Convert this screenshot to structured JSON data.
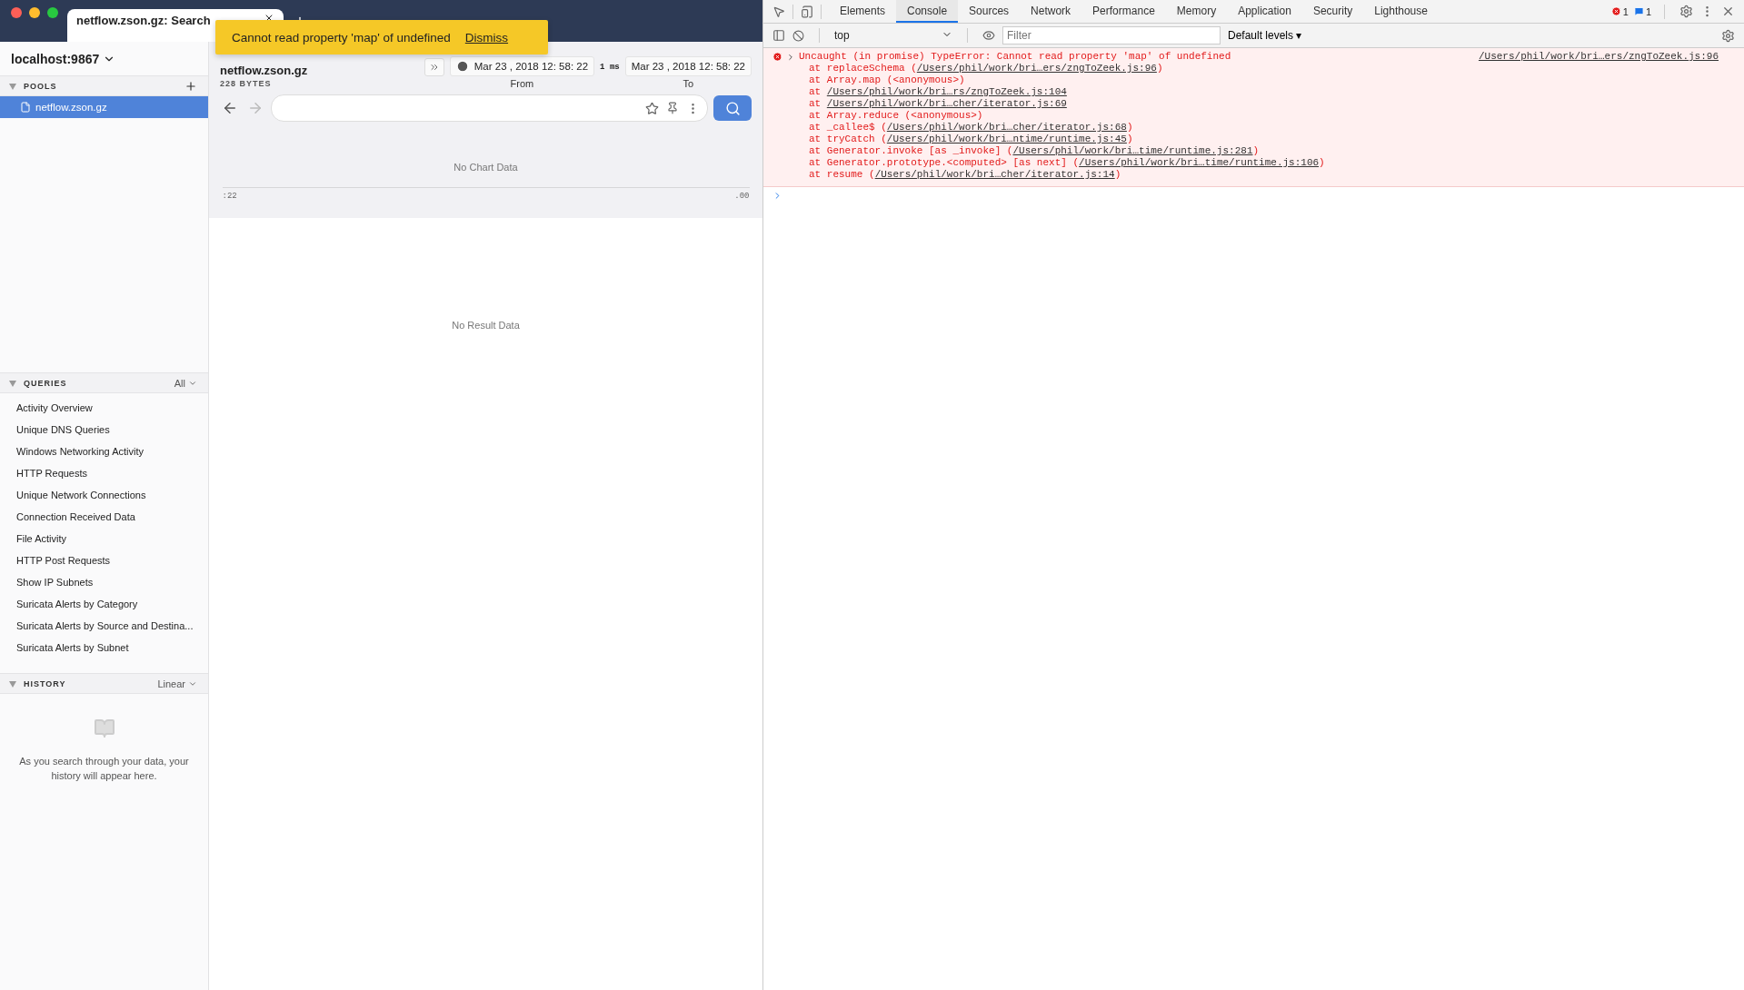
{
  "browser_tab": {
    "title": "netflow.zson.gz: Search"
  },
  "toast": {
    "message": "Cannot read property 'map' of undefined",
    "action": "Dismiss"
  },
  "sidebar": {
    "workspace": "localhost:9867",
    "pools": {
      "title": "POOLS",
      "items": [
        {
          "name": "netflow.zson.gz",
          "selected": true
        }
      ]
    },
    "queries": {
      "title": "QUERIES",
      "filter": "All",
      "items": [
        {
          "name": "Activity Overview",
          "selected": false
        },
        {
          "name": "Unique DNS Queries",
          "selected": false
        },
        {
          "name": "Windows Networking Activity",
          "selected": false
        },
        {
          "name": "HTTP Requests",
          "selected": false
        },
        {
          "name": "Unique Network Connections",
          "selected": false
        },
        {
          "name": "Connection Received Data",
          "selected": false
        },
        {
          "name": "File Activity",
          "selected": false
        },
        {
          "name": "HTTP Post Requests",
          "selected": false
        },
        {
          "name": "Show IP Subnets",
          "selected": false
        },
        {
          "name": "Suricata Alerts by Category",
          "selected": false
        },
        {
          "name": "Suricata Alerts by Source and Destina...",
          "selected": false
        },
        {
          "name": "Suricata Alerts by Subnet",
          "selected": false
        }
      ]
    },
    "history": {
      "title": "HISTORY",
      "mode": "Linear",
      "empty_message": "As you search through your data, your history will appear here."
    }
  },
  "main": {
    "pool_name": "netflow.zson.gz",
    "size": "228 BYTES",
    "from": "Mar 23 , 2018 12: 58: 22",
    "duration": "1 ms",
    "to": "Mar 23 , 2018 12: 58: 22",
    "from_label": "From",
    "to_label": "To",
    "chart": {
      "empty_message": "No Chart Data",
      "axis_labels": [
        ":22",
        ".00"
      ]
    },
    "results": {
      "empty_message": "No Result Data"
    }
  },
  "devtools": {
    "tabs": [
      {
        "label": "Elements",
        "selected": false
      },
      {
        "label": "Console",
        "selected": true
      },
      {
        "label": "Sources",
        "selected": false
      },
      {
        "label": "Network",
        "selected": false
      },
      {
        "label": "Performance",
        "selected": false
      },
      {
        "label": "Memory",
        "selected": false
      },
      {
        "label": "Application",
        "selected": false
      },
      {
        "label": "Security",
        "selected": false
      },
      {
        "label": "Lighthouse",
        "selected": false
      }
    ],
    "error_count": "1",
    "message_count": "1",
    "context": "top",
    "filter_placeholder": "Filter",
    "levels": "Default levels ▾",
    "error": {
      "message": "Uncaught (in promise) TypeError: Cannot read property 'map' of undefined",
      "source": "/Users/phil/work/bri…ers/zngToZeek.js:96",
      "frames": [
        {
          "prefix": "at replaceSchema (",
          "link": "/Users/phil/work/bri…ers/zngToZeek.js:96",
          "suffix": ")"
        },
        {
          "prefix": "at Array.map (<anonymous>)"
        },
        {
          "prefix": "at ",
          "link": "/Users/phil/work/bri…rs/zngToZeek.js:104"
        },
        {
          "prefix": "at ",
          "link": "/Users/phil/work/bri…cher/iterator.js:69"
        },
        {
          "prefix": "at Array.reduce (<anonymous>)"
        },
        {
          "prefix": "at _callee$ (",
          "link": "/Users/phil/work/bri…cher/iterator.js:68",
          "suffix": ")"
        },
        {
          "prefix": "at tryCatch (",
          "link": "/Users/phil/work/bri…ntime/runtime.js:45",
          "suffix": ")"
        },
        {
          "prefix": "at Generator.invoke [as _invoke] (",
          "link": "/Users/phil/work/bri…time/runtime.js:281",
          "suffix": ")"
        },
        {
          "prefix": "at Generator.prototype.<computed> [as next] (",
          "link": "/Users/phil/work/bri…time/runtime.js:106",
          "suffix": ")"
        },
        {
          "prefix": "at resume (",
          "link": "/Users/phil/work/bri…cher/iterator.js:14",
          "suffix": ")"
        }
      ]
    }
  }
}
